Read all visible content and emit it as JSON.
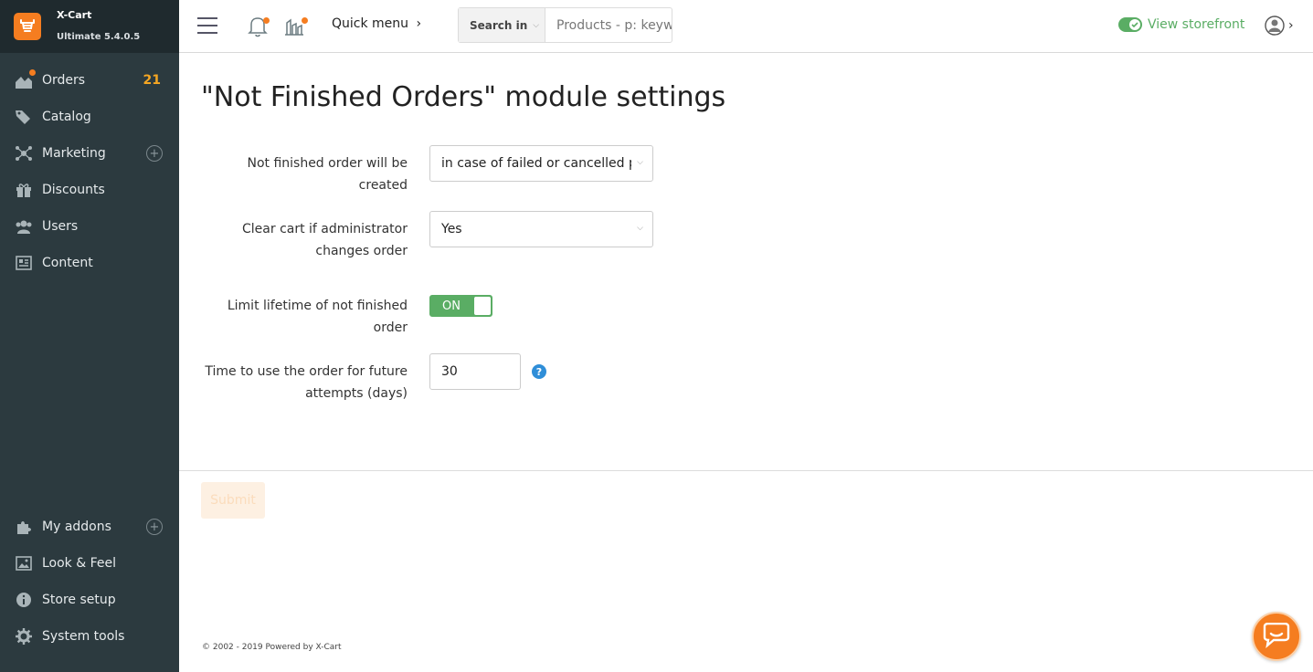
{
  "brand": {
    "name": "X-Cart",
    "version": "Ultimate 5.4.0.5",
    "accent": "#f57d20"
  },
  "sidebar": {
    "background": "#2c3a3f",
    "top_items": [
      {
        "label": "Orders",
        "icon": "orders-icon",
        "count": "21"
      },
      {
        "label": "Catalog",
        "icon": "tag-icon"
      },
      {
        "label": "Marketing",
        "icon": "network-icon"
      },
      {
        "label": "Discounts",
        "icon": "gift-icon"
      },
      {
        "label": "Users",
        "icon": "users-icon"
      },
      {
        "label": "Content",
        "icon": "document-icon"
      }
    ],
    "bottom_items": [
      {
        "label": "My addons",
        "icon": "puzzle-icon"
      },
      {
        "label": "Look & Feel",
        "icon": "image-icon"
      },
      {
        "label": "Store setup",
        "icon": "info-icon"
      },
      {
        "label": "System tools",
        "icon": "gear-icon"
      }
    ]
  },
  "header": {
    "quick_menu": "Quick menu",
    "search_in": "Search in",
    "search_placeholder": "Products - p: keyword",
    "view_storefront": "View storefront"
  },
  "page": {
    "title": "\"Not Finished Orders\" module settings",
    "fields": [
      {
        "label": "Not finished order will be created",
        "value": "in case of failed or cancelled payment"
      },
      {
        "label": "Clear cart if administrator changes order",
        "value": "Yes"
      },
      {
        "label": "Limit lifetime of not finished order",
        "value": "ON"
      },
      {
        "label": "Time to use the order for future attempts (days)",
        "value": "30"
      }
    ],
    "submit": "Submit",
    "help": "?"
  },
  "footer": {
    "text": "© 2002 - 2019 Powered by X-Cart"
  },
  "colors": {
    "success": "#5aad64",
    "info": "#2f8ed8",
    "badge": "#f5a623"
  }
}
